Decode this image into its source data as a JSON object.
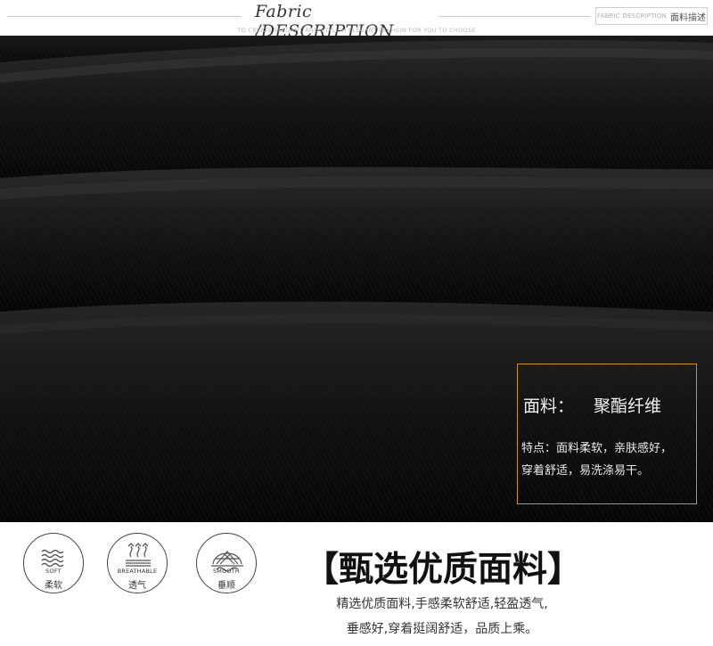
{
  "header": {
    "title_italic": "Fabric",
    "title_caps": "/DESCRIPTION",
    "subtitle": "TO CREATE ELEGANT AND STYLISH ELEGANT FASHION FOR YOU TO CHOOSE",
    "tag_en": "FABRIC DESCRIPTION",
    "tag_zh": "面料描述"
  },
  "info": {
    "fabric_label": "面料：",
    "fabric_value": "聚酯纤维",
    "feature_line1": "特点：面料柔软，亲肤感好，",
    "feature_line2": "穿着舒适，易洗涤易干。"
  },
  "badges": [
    {
      "en": "SOFT",
      "zh": "柔软",
      "icon": "wave-icon"
    },
    {
      "en": "BREATHABLE",
      "zh": "透气",
      "icon": "steam-icon"
    },
    {
      "en": "SMOOTH",
      "zh": "垂顺",
      "icon": "mesh-dome-icon"
    }
  ],
  "headline": "【甄选优质面料】",
  "description": {
    "line1": "精选优质面料,手感柔软舒适,轻盈透气,",
    "line2": "垂感好,穿着挺阔舒适，品质上乘。"
  },
  "colors": {
    "fabric": "#0c0c0c",
    "box_border": "#c8922f",
    "text_dark": "#111111"
  }
}
